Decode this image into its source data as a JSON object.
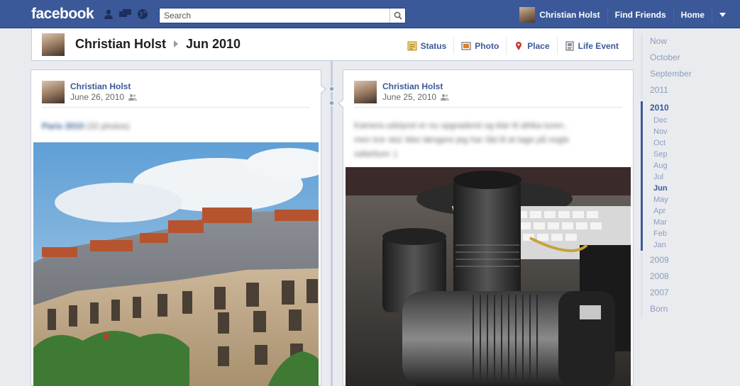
{
  "topbar": {
    "logo": "facebook",
    "search_placeholder": "Search",
    "user_name": "Christian Holst",
    "find_friends": "Find Friends",
    "home": "Home"
  },
  "header": {
    "name": "Christian Holst",
    "date": "Jun 2010",
    "composer": [
      {
        "label": "Status",
        "icon": "status-icon"
      },
      {
        "label": "Photo",
        "icon": "photo-icon"
      },
      {
        "label": "Place",
        "icon": "place-icon"
      },
      {
        "label": "Life Event",
        "icon": "life-event-icon"
      }
    ]
  },
  "posts": {
    "left": {
      "author": "Christian Holst",
      "date": "June 26, 2010",
      "album": "Paris 2010",
      "count": "(32 photos)"
    },
    "right": {
      "author": "Christian Holst",
      "date": "June 25, 2010",
      "text_line1": "Kamera udstyret er nu opgraderet og klar til afrika turen..",
      "text_line2": "men tror ska' ikke længere jeg har råd til at tage på nogle",
      "text_line3": "safariture :)"
    }
  },
  "scrubber": {
    "top": [
      "Now",
      "October",
      "September",
      "2011"
    ],
    "active_year": "2010",
    "months": [
      "Dec",
      "Nov",
      "Oct",
      "Sep",
      "Aug",
      "Jul",
      "Jun",
      "May",
      "Apr",
      "Mar",
      "Feb",
      "Jan"
    ],
    "active_month": "Jun",
    "bottom": [
      "2009",
      "2008",
      "2007",
      "Born"
    ]
  },
  "colors": {
    "brand": "#3b5998",
    "link": "#3b5998",
    "muted": "#8b9dc3"
  }
}
